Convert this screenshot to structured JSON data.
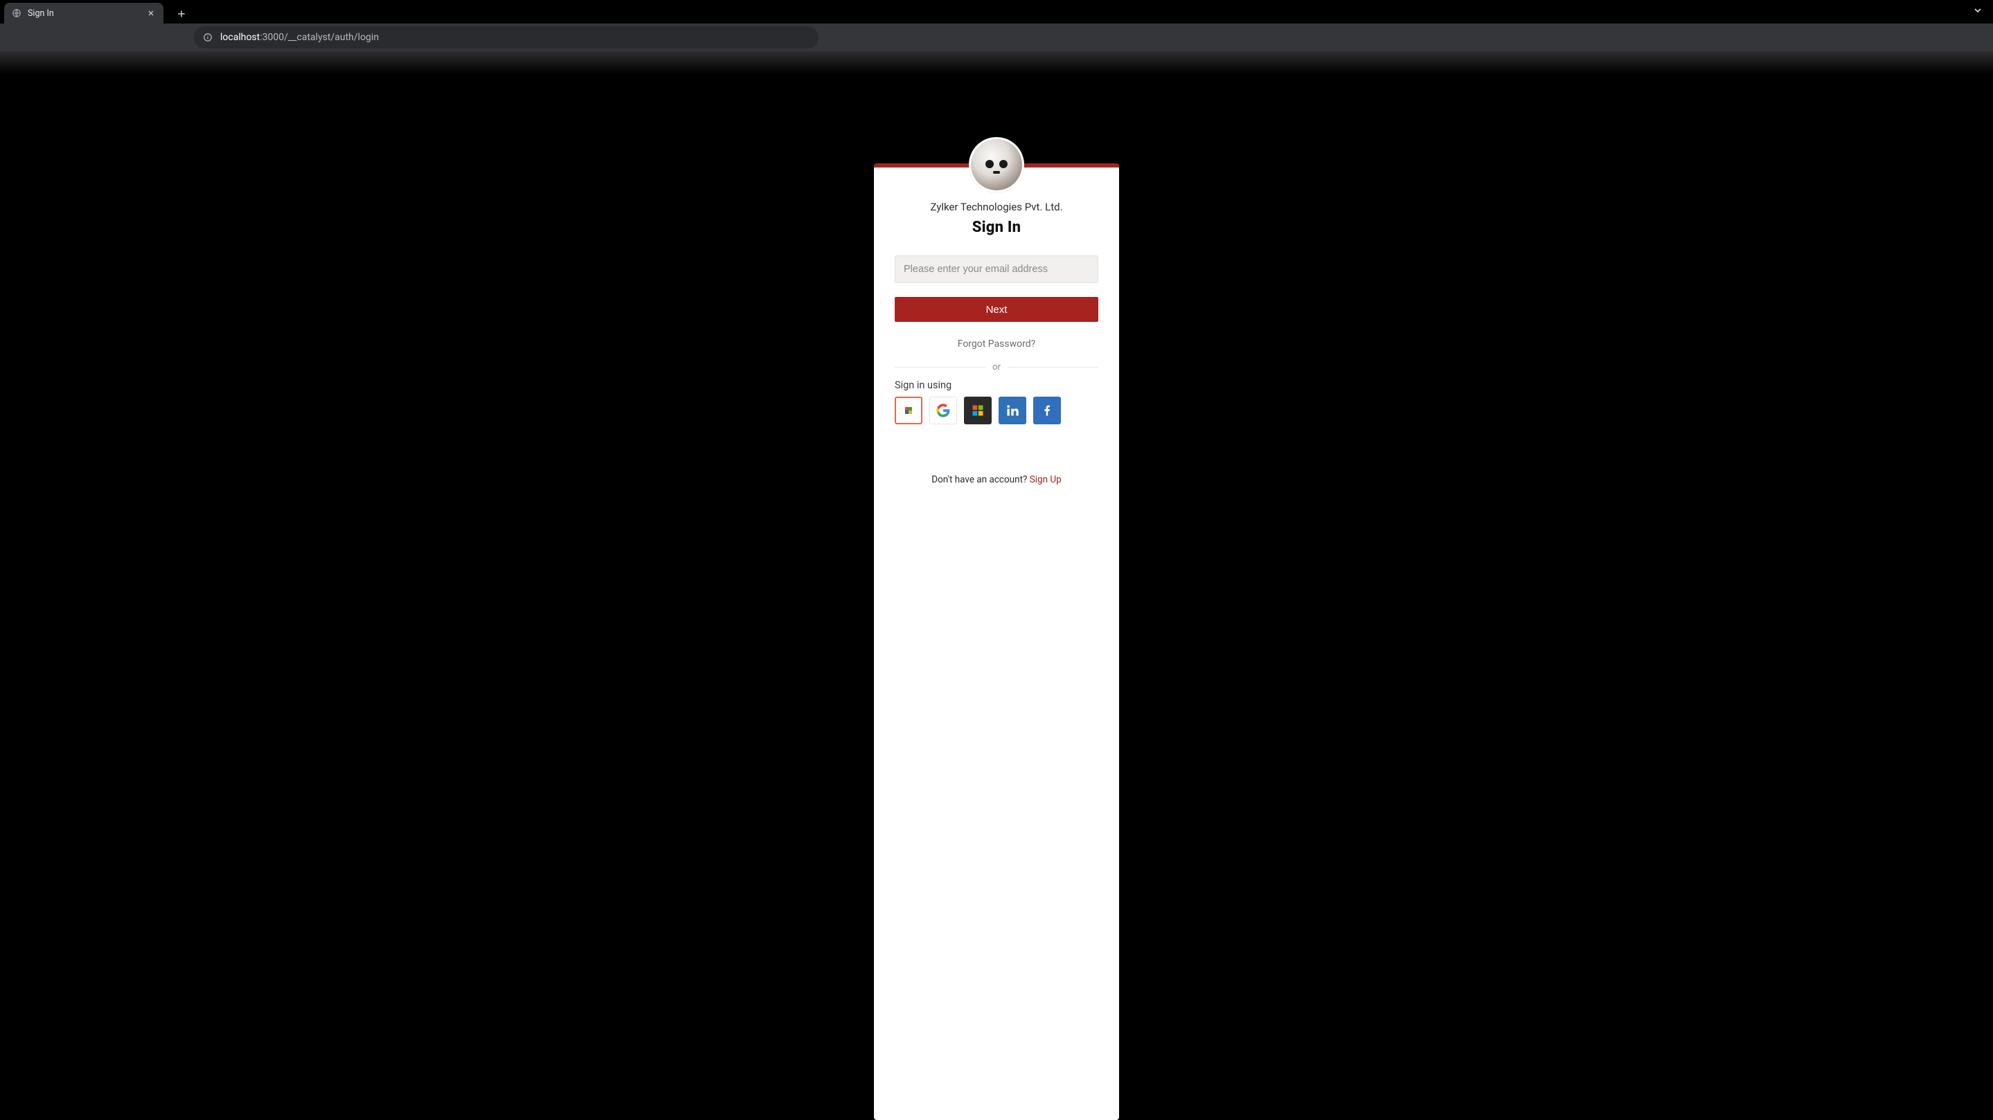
{
  "browser": {
    "tab_title": "Sign In",
    "url_host": "localhost",
    "url_rest": ":3000/__catalyst/auth/login"
  },
  "login": {
    "company": "Zylker Technologies Pvt. Ltd.",
    "heading": "Sign In",
    "email_placeholder": "Please enter your email address",
    "next_label": "Next",
    "forgot_label": "Forgot Password?",
    "or_label": "or",
    "signin_using_label": "Sign in using",
    "providers": {
      "zoho": "Zoho",
      "google": "Google",
      "microsoft": "Microsoft",
      "linkedin": "LinkedIn",
      "facebook": "Facebook"
    },
    "footer_prompt": "Don't have an account? ",
    "signup_label": "Sign Up"
  },
  "colors": {
    "accent": "#a62320"
  }
}
